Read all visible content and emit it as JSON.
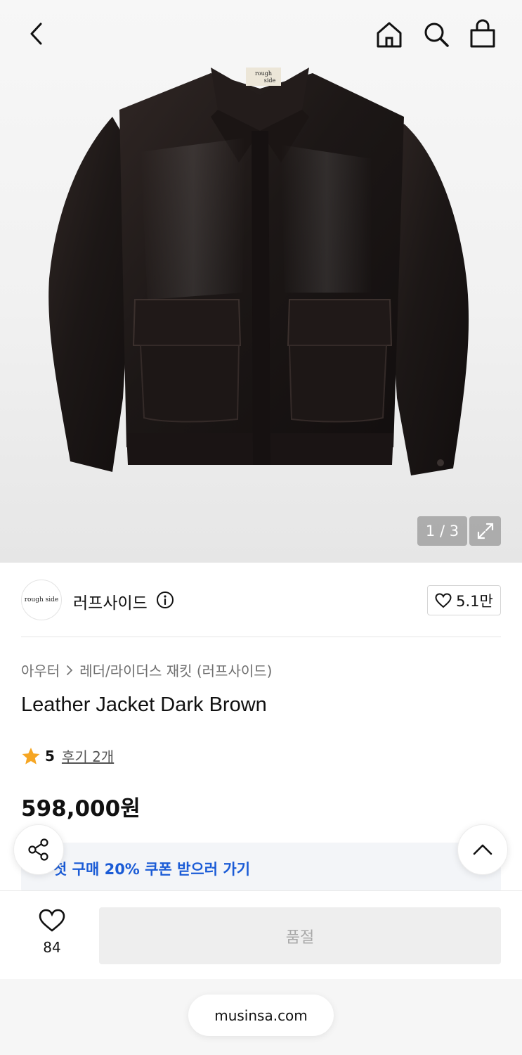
{
  "gallery": {
    "counter": "1 / 3",
    "photo_label_line1": "rough",
    "photo_label_line2": "side"
  },
  "brand": {
    "logo_text": "rough side",
    "name": "러프사이드",
    "likes": "5.1만"
  },
  "breadcrumb": {
    "category": "아우터",
    "sub_category": "레더/라이더스 재킷 (러프사이드)"
  },
  "product": {
    "title": "Leather Jacket Dark Brown",
    "rating": "5",
    "reviews": "후기 2개",
    "price": "598,000원"
  },
  "coupon": {
    "text": "첫 구매 20% 쿠폰 받으러 가기"
  },
  "bottom_bar": {
    "wish_count": "84",
    "buy_button": "품절"
  },
  "browser": {
    "url": "musinsa.com"
  },
  "colors": {
    "accent_blue": "#1a5bd6",
    "star": "#f6a623",
    "soldout_bg": "#eeeeee"
  },
  "icons": {
    "back": "chevron-left-icon",
    "home": "home-icon",
    "search": "search-icon",
    "bag": "shopping-bag-icon",
    "expand": "expand-icon",
    "info": "info-icon",
    "heart": "heart-icon",
    "star": "star-icon",
    "share": "share-icon",
    "scroll_top": "chevron-up-icon"
  }
}
